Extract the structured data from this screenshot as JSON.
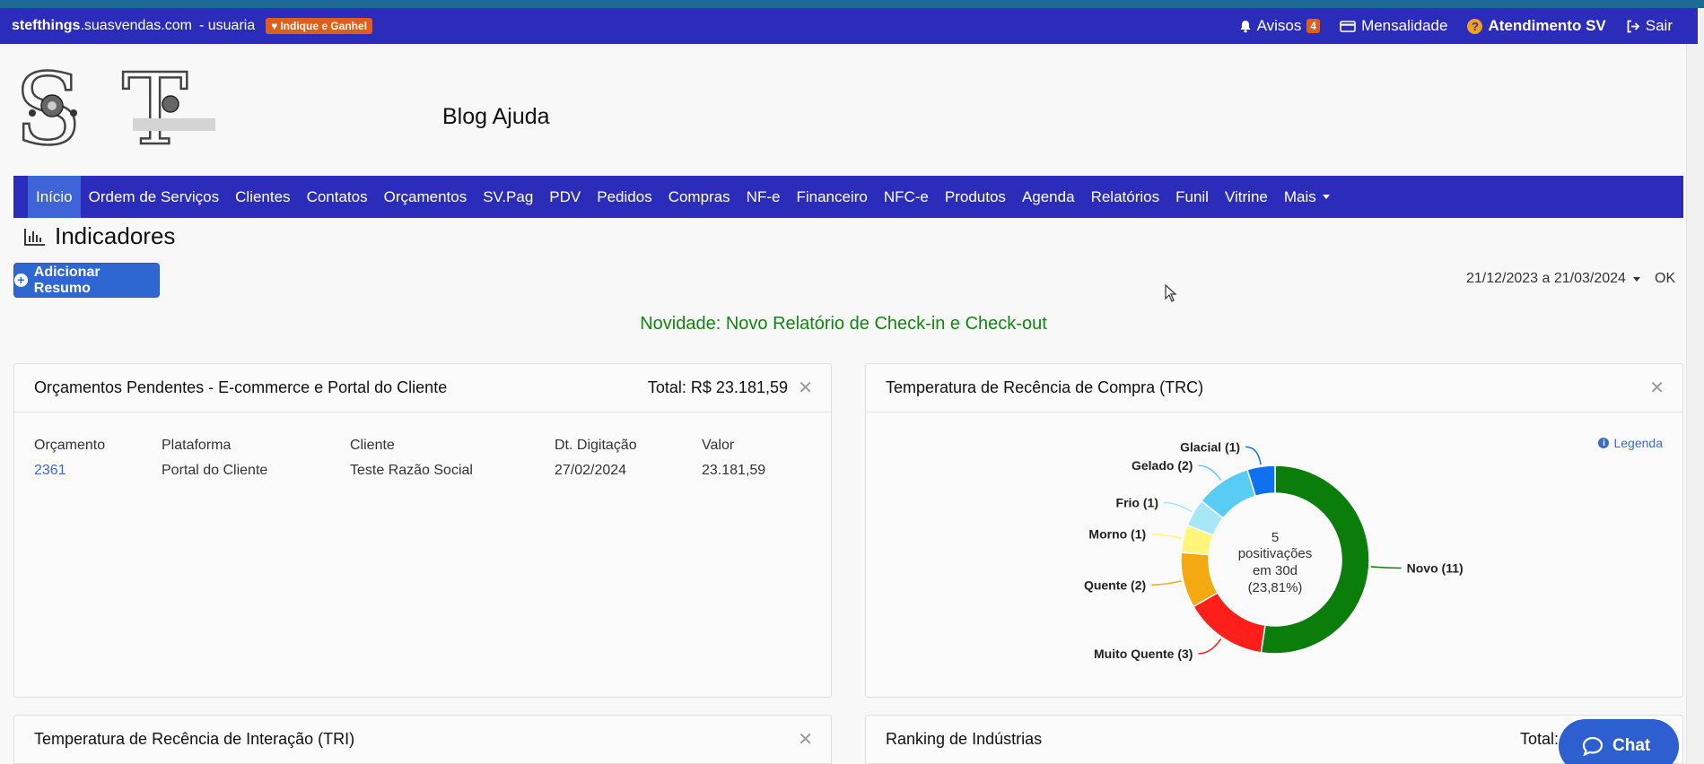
{
  "topbar": {
    "site_bold": "stefthings",
    "site_rest": ".suasvendas.com",
    "user": "- usuaria",
    "indique_label": "Indique e Ganhel",
    "avisos_label": "Avisos",
    "avisos_count": "4",
    "mensalidade_label": "Mensalidade",
    "atendimento_label": "Atendimento SV",
    "sair_label": "Sair"
  },
  "header": {
    "blog_label": "Blog Ajuda"
  },
  "nav": {
    "items": [
      "Início",
      "Ordem de Serviços",
      "Clientes",
      "Contatos",
      "Orçamentos",
      "SV.Pag",
      "PDV",
      "Pedidos",
      "Compras",
      "NF-e",
      "Financeiro",
      "NFC-e",
      "Produtos",
      "Agenda",
      "Relatórios",
      "Funil",
      "Vitrine",
      "Mais"
    ],
    "active": "Início"
  },
  "page": {
    "title": "Indicadores",
    "add_button": "Adicionar Resumo",
    "date_range": "21/12/2023 a 21/03/2024",
    "ok_label": "OK",
    "novidade": "Novidade: Novo Relatório de Check-in e Check-out"
  },
  "orcamentos_card": {
    "title": "Orçamentos Pendentes - E-commerce e Portal do Cliente",
    "total": "Total: R$ 23.181,59",
    "columns": [
      "Orçamento",
      "Plataforma",
      "Cliente",
      "Dt. Digitação",
      "Valor"
    ],
    "rows": [
      [
        "2361",
        "Portal do Cliente",
        "Teste Razão Social",
        "27/02/2024",
        "23.181,59"
      ]
    ]
  },
  "trc_card": {
    "title": "Temperatura de Recência de Compra (TRC)",
    "legend_link": "Legenda",
    "center": [
      "5",
      "positivações",
      "em 30d",
      "(23,81%)"
    ]
  },
  "tri_card": {
    "title": "Temperatura de Recência de Interação (TRI)"
  },
  "ranking_card": {
    "title": "Ranking de Indústrias",
    "total": "Total: R$"
  },
  "chat_label": "Chat",
  "colors": {
    "primary_nav": "#2b2dba",
    "active_nav": "#3f64d8",
    "green_text": "#118511",
    "orange_badge": "#e35d1a"
  },
  "chart_data": {
    "type": "pie",
    "title": "",
    "series": [
      {
        "values": [
          11,
          3,
          2,
          1,
          1,
          2,
          1
        ],
        "categories": [
          "Novo",
          "Muito Quente",
          "Quente",
          "Morno",
          "Frio",
          "Gelado",
          "Glacial"
        ],
        "labels": [
          "Novo (11)",
          "Muito Quente (3)",
          "Quente (2)",
          "Morno (1)",
          "Frio (1)",
          "Gelado (2)",
          "Glacial (1)"
        ],
        "colors": [
          "#0b7d0b",
          "#ff1f1a",
          "#f5a911",
          "#fff57a",
          "#a6e6f5",
          "#58ccf5",
          "#0f70f0"
        ]
      }
    ]
  }
}
